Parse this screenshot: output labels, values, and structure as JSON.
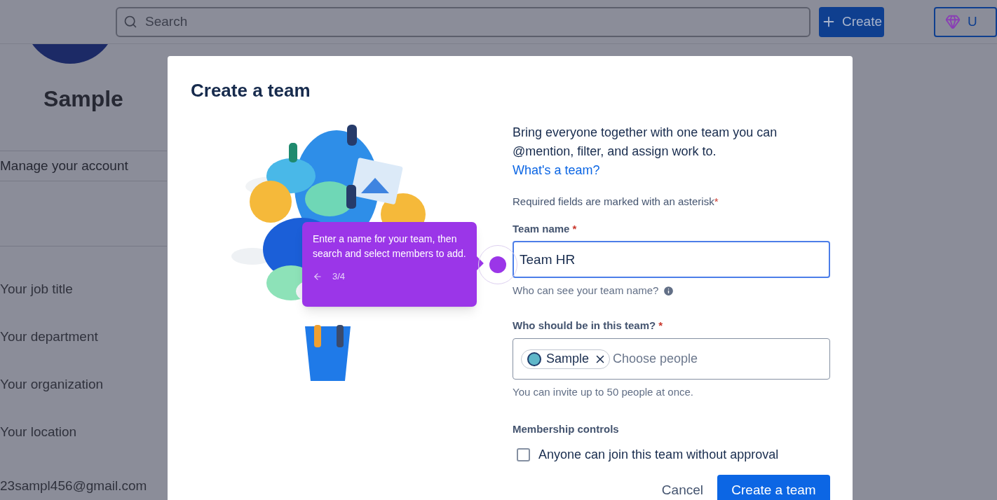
{
  "top_bar": {
    "search": {
      "placeholder": "Search"
    },
    "create_button": "Create",
    "upgrade_button": "U"
  },
  "profile": {
    "name": "Sample",
    "manage_link": "Manage your account",
    "fields": [
      "Your job title",
      "Your department",
      "Your organization",
      "Your location"
    ],
    "email": "23sampl456@gmail.com"
  },
  "dialog": {
    "title": "Create a team",
    "intro": "Bring everyone together with one team you can @mention, filter, and assign work to.",
    "intro_link": "What's a team?",
    "required_note": "Required fields are marked with an asterisk",
    "required_note_mark": "*",
    "team_name": {
      "label": "Team name",
      "required_mark": "*",
      "value": "Team HR",
      "focused": true,
      "hint": "Who can see your team name?"
    },
    "members": {
      "label": "Who should be in this team?",
      "required_mark": "*",
      "chips": [
        {
          "name": "Sample"
        }
      ],
      "placeholder": "Choose people",
      "hint": "You can invite up to 50 people at once."
    },
    "membership": {
      "heading": "Membership controls",
      "checkbox": {
        "label": "Anyone can join this team without approval",
        "checked": false
      }
    },
    "buttons": {
      "cancel": "Cancel",
      "submit": "Create a team"
    }
  },
  "tour_tooltip": {
    "text": "Enter a name for your team, then search and select members to add.",
    "step": "3/4"
  }
}
